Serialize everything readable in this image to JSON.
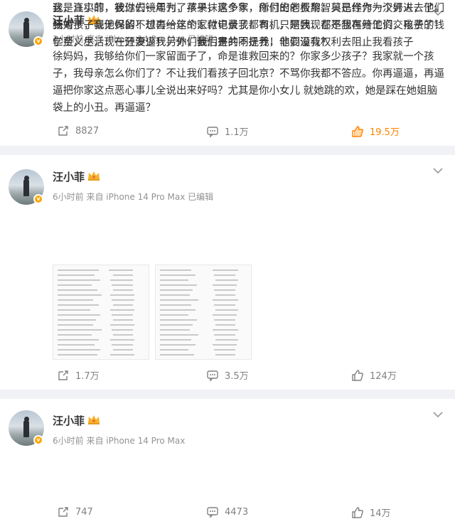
{
  "posts": [
    {
      "author": "汪小菲",
      "meta": "3小时前  来自 iPhone 14 Pro Max 已编辑",
      "text": "徐妈妈，我够给你们一家留面子了，命是谁救回来的？你家多少孩子？我家就一个孩子，我母亲怎么你们了？不让我们看孩子回北京？不骂你我都不答应。你再逼逼，再逼逼把你家这点恶心事儿全说出来好吗？尤其是你小女儿 就她跳的欢，她是踩在她姐脑袋上的小丑。再逼逼？",
      "share_count": "8827",
      "comment_count": "1.1万",
      "like_count": "19.5万",
      "liked": true
    },
    {
      "author": "汪小菲",
      "meta": "6小时前  来自 iPhone 14 Pro Max 已编辑",
      "text": "这是真实的，我过去一年为了孩子，这个家，所付出的费用。只是作为一个男人，他们结婚了，我他妈的不想再给这个家付电费了！司机，阿姨，都是我在开工资，孩子的钱学费，生活，一分没少！另外，我们是共同抚养！他们没有权利去阻止我看孩子",
      "share_count": "1.7万",
      "comment_count": "3.5万",
      "like_count": "124万",
      "liked": false
    },
    {
      "author": "汪小菲",
      "meta": "6小时前  来自 iPhone 14 Pro Max",
      "text": "我，汪小菲，被你们镜周刊，苹果抹黑多年，你们的老板黎智英已经作为汉奸进去了。我对孩子毫无保留！过去一年的汇款记录我都有，只是我现在不想再给他们交电费了！仁至义尽，现在还要逼我，你们最后害的不是我，非要逼我？",
      "share_count": "747",
      "comment_count": "4473",
      "like_count": "14万",
      "liked": false
    }
  ],
  "icons": {
    "share": "share-icon",
    "comment": "comment-icon",
    "like": "thumbs-up-icon",
    "more": "chevron-down-icon",
    "verified": "verified-badge-icon",
    "crown": "vip-crown-icon"
  },
  "colors": {
    "liked": "#ff8200",
    "verified": "#ffa400",
    "muted": "#939393"
  }
}
